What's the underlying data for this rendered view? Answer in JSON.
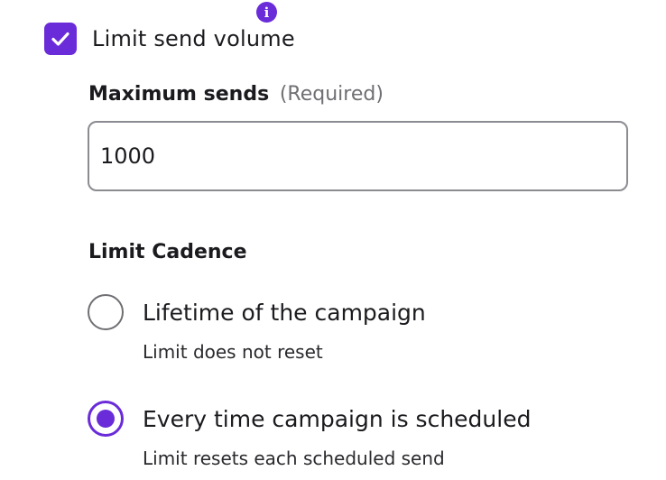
{
  "limit_send_volume": {
    "label": "Limit send volume",
    "checked": true,
    "info_icon": "info-icon"
  },
  "maximum_sends": {
    "label": "Maximum sends",
    "required_text": "(Required)",
    "value": "1000"
  },
  "limit_cadence": {
    "heading": "Limit Cadence",
    "options": [
      {
        "title": "Lifetime of the campaign",
        "description": "Limit does not reset",
        "selected": false
      },
      {
        "title": "Every time campaign is scheduled",
        "description": "Limit resets each scheduled send",
        "selected": true
      }
    ]
  },
  "colors": {
    "accent": "#6a2bd9",
    "text": "#1b1b1f",
    "muted": "#6f6f74",
    "input_border": "#8b8b92"
  }
}
